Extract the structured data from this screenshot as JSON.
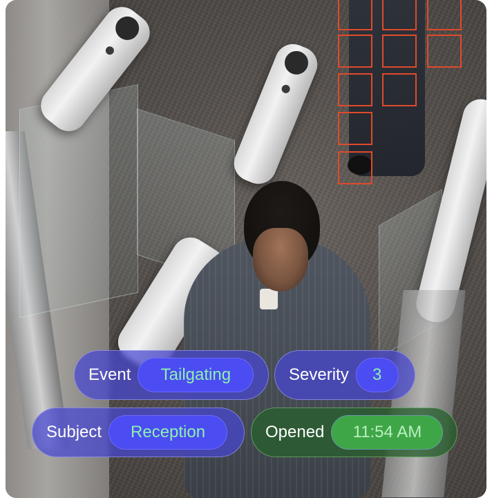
{
  "tags": {
    "event": {
      "label": "Event",
      "value": "Tailgating"
    },
    "severity": {
      "label": "Severity",
      "value": "3"
    },
    "subject": {
      "label": "Subject",
      "value": "Reception"
    },
    "opened": {
      "label": "Opened",
      "value": "11:54 AM"
    }
  },
  "colors": {
    "tag_blue": "#4b4cf2",
    "tag_value_text": "#8ef0b0",
    "tag_green": "#3fa648",
    "detection_box": "#e14a2b"
  },
  "detection_boxes_count": 11
}
